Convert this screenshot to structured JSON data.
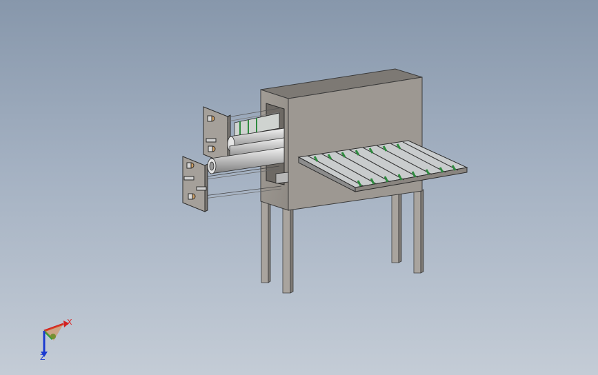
{
  "viewport": {
    "background_top": "#8797ab",
    "background_bottom": "#c4ccd6"
  },
  "model": {
    "frame_color": "#9a958f",
    "belt_accent_color": "#2e8a3e"
  },
  "triad": {
    "x_label": "X",
    "z_label": "Z",
    "x_color": "#d22222",
    "y_color": "#22a23a",
    "z_color": "#1a3ad0"
  }
}
